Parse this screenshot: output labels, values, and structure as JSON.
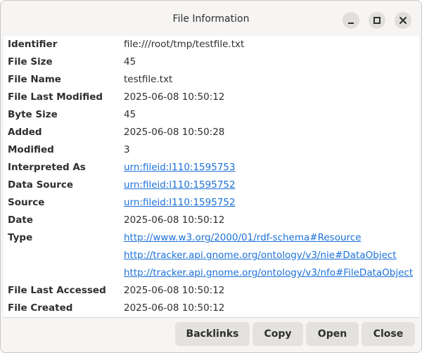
{
  "window": {
    "title": "File Information"
  },
  "properties": [
    {
      "label": "Identifier",
      "values": [
        "file:///root/tmp/testfile.txt"
      ],
      "link": false
    },
    {
      "label": "File Size",
      "values": [
        "45"
      ],
      "link": false
    },
    {
      "label": "File Name",
      "values": [
        "testfile.txt"
      ],
      "link": false
    },
    {
      "label": "File Last Modified",
      "values": [
        "2025-06-08 10:50:12"
      ],
      "link": false
    },
    {
      "label": "Byte Size",
      "values": [
        "45"
      ],
      "link": false
    },
    {
      "label": "Added",
      "values": [
        "2025-06-08 10:50:28"
      ],
      "link": false
    },
    {
      "label": "Modified",
      "values": [
        "3"
      ],
      "link": false
    },
    {
      "label": "Interpreted As",
      "values": [
        "urn:fileid:l110:1595753"
      ],
      "link": true
    },
    {
      "label": "Data Source",
      "values": [
        "urn:fileid:l110:1595752"
      ],
      "link": true
    },
    {
      "label": "Source",
      "values": [
        "urn:fileid:l110:1595752"
      ],
      "link": true
    },
    {
      "label": "Date",
      "values": [
        "2025-06-08 10:50:12"
      ],
      "link": false
    },
    {
      "label": "Type",
      "values": [
        "http://www.w3.org/2000/01/rdf-schema#Resource",
        "http://tracker.api.gnome.org/ontology/v3/nie#DataObject",
        "http://tracker.api.gnome.org/ontology/v3/nfo#FileDataObject"
      ],
      "link": true
    },
    {
      "label": "File Last Accessed",
      "values": [
        "2025-06-08 10:50:12"
      ],
      "link": false
    },
    {
      "label": "File Created",
      "values": [
        "2025-06-08 10:50:12"
      ],
      "link": false
    }
  ],
  "buttons": {
    "backlinks": "Backlinks",
    "copy": "Copy",
    "open": "Open",
    "close": "Close"
  },
  "icons": {
    "minimize": "minimize-icon",
    "maximize": "maximize-icon",
    "close": "close-icon"
  }
}
